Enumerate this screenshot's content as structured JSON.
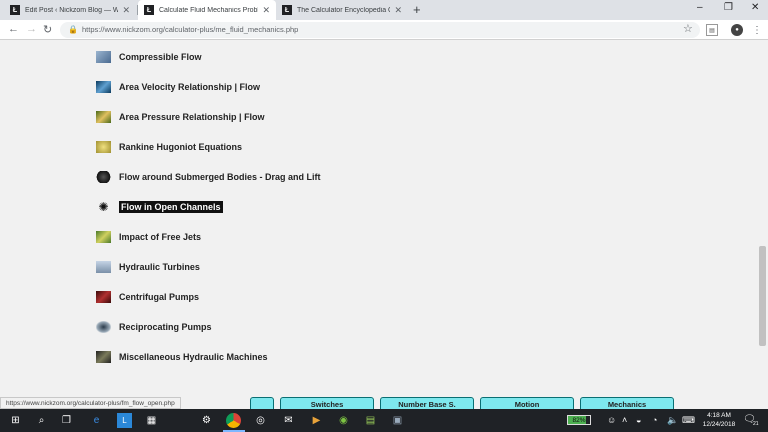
{
  "tabs": [
    {
      "title": "Edit Post ‹ Nickzom Blog — Wo",
      "active": false
    },
    {
      "title": "Calculate Fluid Mechanics Proble",
      "active": true
    },
    {
      "title": "The Calculator Encyclopedia Calc",
      "active": false
    }
  ],
  "tab_favicon_letter": "Ł",
  "new_tab_glyph": "+",
  "window_controls": {
    "minimize": "–",
    "maximize": "❐",
    "close": "✕"
  },
  "toolbar": {
    "back": "←",
    "forward": "→",
    "reload": "↻",
    "url": "https://www.nickzom.org/calculator-plus/me_fluid_mechanics.php",
    "star": "☆"
  },
  "items": [
    {
      "label": "Compressible Flow",
      "icon": "compressible-flow-thumb",
      "color": "#6b8fb5"
    },
    {
      "label": "Area Velocity Relationship | Flow",
      "icon": "area-velocity-thumb",
      "color": "#1c5a8a"
    },
    {
      "label": "Area Pressure Relationship | Flow",
      "icon": "area-pressure-thumb",
      "color": "#6a8a2a"
    },
    {
      "label": "Rankine Hugoniot Equations",
      "icon": "rankine-thumb",
      "color": "#c8b84a"
    },
    {
      "label": "Flow around Submerged Bodies - Drag and Lift",
      "icon": "submerged-bodies-thumb",
      "color": "#333333"
    },
    {
      "label": "Flow in Open Channels",
      "icon": "open-channels-thumb",
      "color": "#ffffff",
      "selected": true
    },
    {
      "label": "Impact of Free Jets",
      "icon": "free-jets-thumb",
      "color": "#7a9a3a"
    },
    {
      "label": "Hydraulic Turbines",
      "icon": "hydraulic-turbines-thumb",
      "color": "#8aa0bb"
    },
    {
      "label": "Centrifugal Pumps",
      "icon": "centrifugal-pumps-thumb",
      "color": "#8a1f1f"
    },
    {
      "label": "Reciprocating Pumps",
      "icon": "reciprocating-pumps-thumb",
      "color": "#5a6a7a"
    },
    {
      "label": "Miscellaneous Hydraulic Machines",
      "icon": "misc-machines-thumb",
      "color": "#3a3a2a"
    }
  ],
  "status_url": "https://www.nickzom.org/calculator-plus/fm_flow_open.php",
  "bottom_buttons": [
    "Switches",
    "Number Base S.",
    "Motion",
    "Mechanics"
  ],
  "battery_percent": "82%",
  "battery_level": 0.82,
  "clock": {
    "time": "4:18 AM",
    "date": "12/24/2018"
  },
  "notification_count": "21"
}
